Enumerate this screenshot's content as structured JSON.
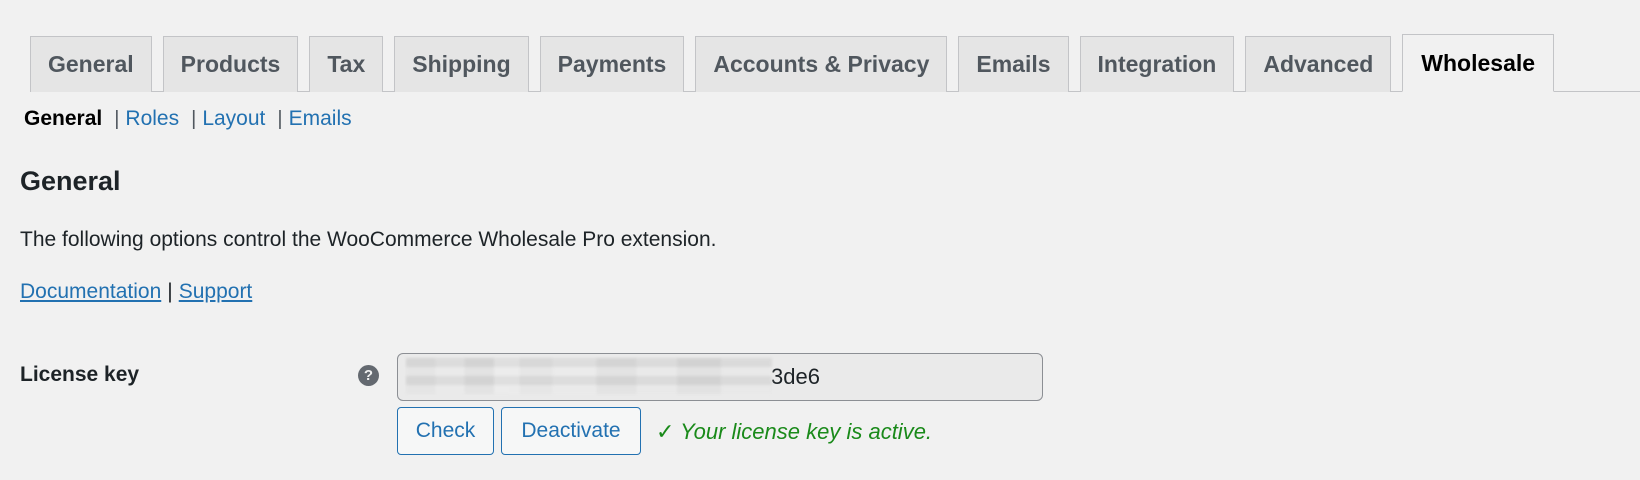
{
  "tabs": [
    {
      "label": "General",
      "active": false
    },
    {
      "label": "Products",
      "active": false
    },
    {
      "label": "Tax",
      "active": false
    },
    {
      "label": "Shipping",
      "active": false
    },
    {
      "label": "Payments",
      "active": false
    },
    {
      "label": "Accounts & Privacy",
      "active": false
    },
    {
      "label": "Emails",
      "active": false
    },
    {
      "label": "Integration",
      "active": false
    },
    {
      "label": "Advanced",
      "active": false
    },
    {
      "label": "Wholesale",
      "active": true
    }
  ],
  "subnav": {
    "current": "General",
    "links": [
      "Roles",
      "Layout",
      "Emails"
    ],
    "separator": "|"
  },
  "section": {
    "heading": "General",
    "description": "The following options control the WooCommerce Wholesale Pro extension.",
    "links": {
      "documentation": "Documentation",
      "separator": "|",
      "support": "Support"
    }
  },
  "license": {
    "label": "License key",
    "help_icon": "question-circle-icon",
    "help_glyph": "?",
    "visible_value": "3de6",
    "check_label": "Check",
    "deactivate_label": "Deactivate",
    "status_text": "✓ Your license key is active."
  },
  "colors": {
    "link": "#2271b1",
    "success": "#1a8a1a",
    "background": "#f1f1f1"
  }
}
